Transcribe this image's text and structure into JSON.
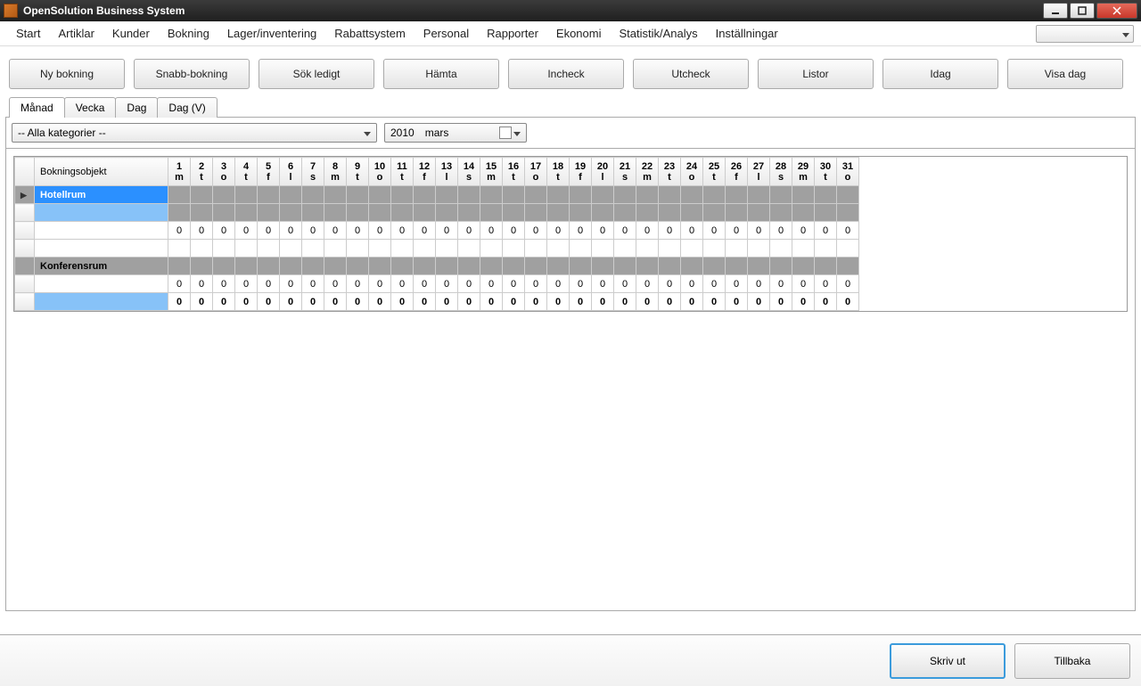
{
  "window": {
    "title": "OpenSolution Business System"
  },
  "menu": [
    "Start",
    "Artiklar",
    "Kunder",
    "Bokning",
    "Lager/inventering",
    "Rabattsystem",
    "Personal",
    "Rapporter",
    "Ekonomi",
    "Statistik/Analys",
    "Inställningar"
  ],
  "toolbar": [
    "Ny bokning",
    "Snabb-bokning",
    "Sök ledigt",
    "Hämta",
    "Incheck",
    "Utcheck",
    "Listor",
    "Idag",
    "Visa dag"
  ],
  "tabs": {
    "items": [
      "Månad",
      "Vecka",
      "Dag",
      "Dag (V)"
    ],
    "active": 0
  },
  "filters": {
    "category": "-- Alla kategorier --",
    "year": "2010",
    "month": "mars"
  },
  "grid": {
    "object_header": "Bokningsobjekt",
    "days": [
      {
        "n": "1",
        "d": "m"
      },
      {
        "n": "2",
        "d": "t"
      },
      {
        "n": "3",
        "d": "o"
      },
      {
        "n": "4",
        "d": "t"
      },
      {
        "n": "5",
        "d": "f"
      },
      {
        "n": "6",
        "d": "l"
      },
      {
        "n": "7",
        "d": "s"
      },
      {
        "n": "8",
        "d": "m"
      },
      {
        "n": "9",
        "d": "t"
      },
      {
        "n": "10",
        "d": "o"
      },
      {
        "n": "11",
        "d": "t"
      },
      {
        "n": "12",
        "d": "f"
      },
      {
        "n": "13",
        "d": "l"
      },
      {
        "n": "14",
        "d": "s"
      },
      {
        "n": "15",
        "d": "m"
      },
      {
        "n": "16",
        "d": "t"
      },
      {
        "n": "17",
        "d": "o"
      },
      {
        "n": "18",
        "d": "t"
      },
      {
        "n": "19",
        "d": "f"
      },
      {
        "n": "20",
        "d": "l"
      },
      {
        "n": "21",
        "d": "s"
      },
      {
        "n": "22",
        "d": "m"
      },
      {
        "n": "23",
        "d": "t"
      },
      {
        "n": "24",
        "d": "o"
      },
      {
        "n": "25",
        "d": "t"
      },
      {
        "n": "26",
        "d": "f"
      },
      {
        "n": "27",
        "d": "l"
      },
      {
        "n": "28",
        "d": "s"
      },
      {
        "n": "29",
        "d": "m"
      },
      {
        "n": "30",
        "d": "t"
      },
      {
        "n": "31",
        "d": "o"
      }
    ],
    "rows": [
      {
        "type": "category",
        "label": "Hotellrum",
        "selected": true,
        "marker": true
      },
      {
        "type": "data",
        "label": "",
        "values_fill": "",
        "cls": "blue-row",
        "grey": true
      },
      {
        "type": "data",
        "label": "",
        "values_fill": "0"
      },
      {
        "type": "data",
        "label": "",
        "values_fill": ""
      },
      {
        "type": "category",
        "label": "Konferensrum"
      },
      {
        "type": "data",
        "label": "",
        "values_fill": "0"
      },
      {
        "type": "data",
        "label": "",
        "values_fill": "0",
        "cls": "bold-row blue-row"
      }
    ]
  },
  "footer": {
    "print": "Skriv ut",
    "back": "Tillbaka"
  }
}
